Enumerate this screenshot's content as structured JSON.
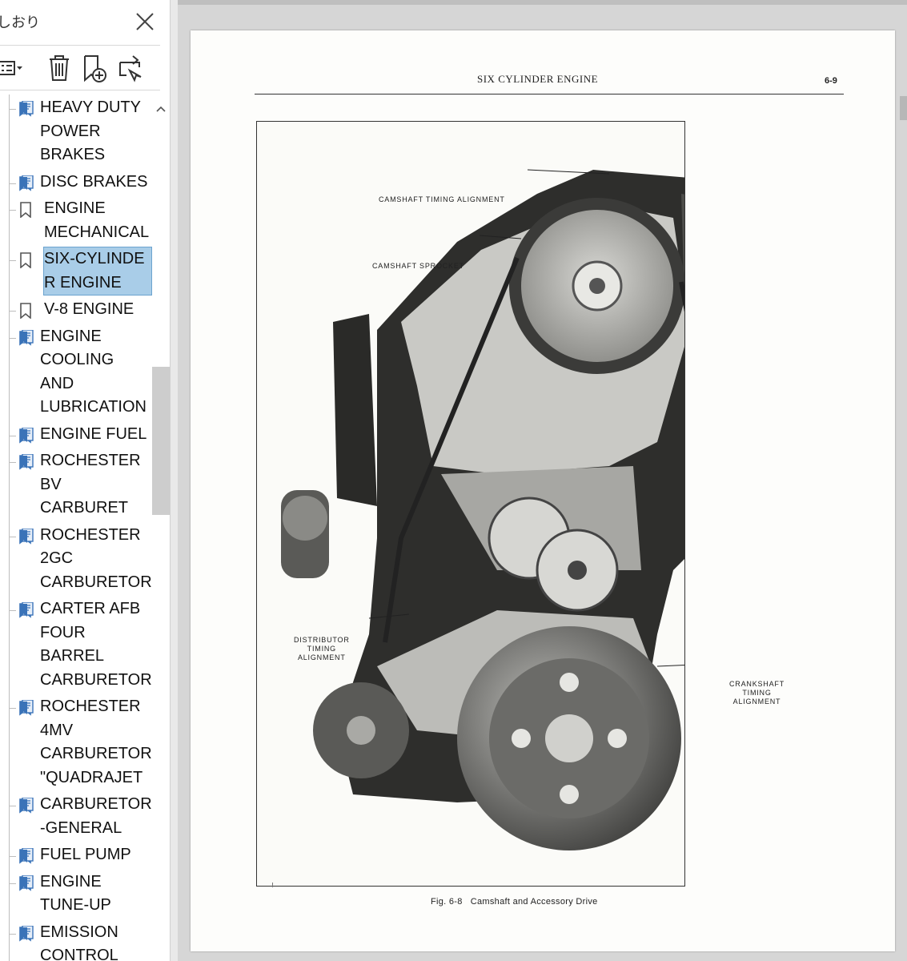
{
  "sidebar": {
    "title": "しおり",
    "items": [
      {
        "label": "HEAVY DUTY\nPOWER\nBRAKES",
        "icon": "bookmark-page-icon",
        "selected": false
      },
      {
        "label": "DISC BRAKES",
        "icon": "bookmark-page-icon",
        "selected": false
      },
      {
        "label": "ENGINE\nMECHANICAL",
        "icon": "bookmark-icon",
        "selected": false
      },
      {
        "label": "SIX-CYLINDER ENGINE",
        "icon": "bookmark-icon",
        "selected": true
      },
      {
        "label": "V-8 ENGINE",
        "icon": "bookmark-icon",
        "selected": false
      },
      {
        "label": "ENGINE\nCOOLING\nAND\nLUBRICATION",
        "icon": "bookmark-page-icon",
        "selected": false
      },
      {
        "label": "ENGINE FUEL",
        "icon": "bookmark-page-icon",
        "selected": false
      },
      {
        "label": "ROCHESTER\nBV CARBURET",
        "icon": "bookmark-page-icon",
        "selected": false
      },
      {
        "label": "ROCHESTER\n2GC\nCARBURETOR",
        "icon": "bookmark-page-icon",
        "selected": false
      },
      {
        "label": "CARTER AFB\nFOUR BARREL\nCARBURETOR",
        "icon": "bookmark-page-icon",
        "selected": false
      },
      {
        "label": "ROCHESTER\n4MV\nCARBURETOR\n\"QUADRAJET",
        "icon": "bookmark-page-icon",
        "selected": false
      },
      {
        "label": "CARBURETOR\n-GENERAL",
        "icon": "bookmark-page-icon",
        "selected": false
      },
      {
        "label": "FUEL PUMP",
        "icon": "bookmark-page-icon",
        "selected": false
      },
      {
        "label": "ENGINE\nTUNE-UP",
        "icon": "bookmark-page-icon",
        "selected": false
      },
      {
        "label": "EMISSION\nCONTROL\nSYSTEMS",
        "icon": "bookmark-page-icon",
        "selected": false
      }
    ],
    "toolbar": {
      "options_icon": "list-options-icon",
      "delete_icon": "trash-icon",
      "new_bookmark_icon": "new-bookmark-icon",
      "expand_icon": "expand-bookmark-icon"
    }
  },
  "document": {
    "header_title": "SIX CYLINDER ENGINE",
    "page_number": "6-9",
    "caption": "Fig. 6-8   Camshaft and Accessory Drive",
    "callouts": {
      "camshaft_timing": "CAMSHAFT TIMING ALIGNMENT",
      "camshaft_sprocket": "CAMSHAFT SPROCKET",
      "distributor_1": "DISTRIBUTOR",
      "distributor_2": "TIMING",
      "distributor_3": "ALIGNMENT",
      "crankshaft_1": "CRANKSHAFT",
      "crankshaft_2": "TIMING",
      "crankshaft_3": "ALIGNMENT"
    }
  },
  "colors": {
    "selection": "#a9cde8",
    "bookmark_blue": "#3a73b8",
    "viewer_bg": "#d6d6d6"
  }
}
